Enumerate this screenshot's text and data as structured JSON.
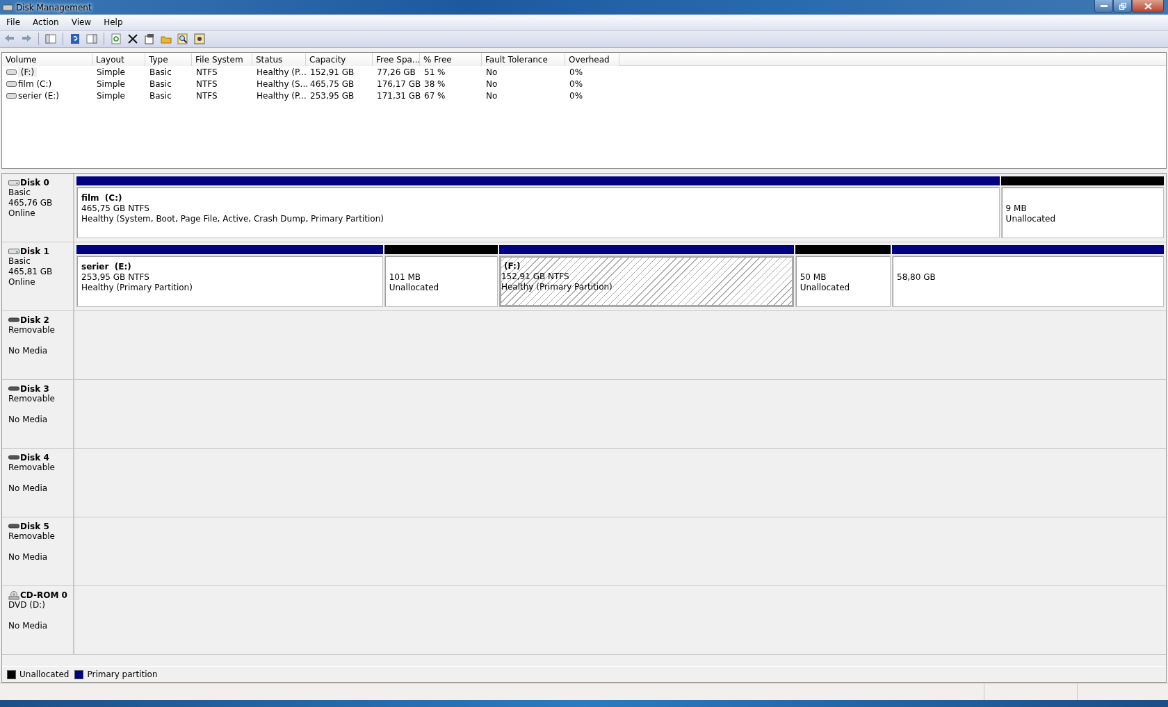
{
  "window": {
    "title": "Disk Management"
  },
  "menu": [
    "File",
    "Action",
    "View",
    "Help"
  ],
  "volume_list": {
    "columns": [
      "Volume",
      "Layout",
      "Type",
      "File System",
      "Status",
      "Capacity",
      "Free Spa...",
      "% Free",
      "Fault Tolerance",
      "Overhead"
    ],
    "rows": [
      {
        "cells": [
          " (F:)",
          "Simple",
          "Basic",
          "NTFS",
          "Healthy (P...",
          "152,91 GB",
          "77,26 GB",
          "51 %",
          "No",
          "0%"
        ],
        "selected": true
      },
      {
        "cells": [
          "film (C:)",
          "Simple",
          "Basic",
          "NTFS",
          "Healthy (S...",
          "465,75 GB",
          "176,17 GB",
          "38 %",
          "No",
          "0%"
        ],
        "selected": false
      },
      {
        "cells": [
          "serier (E:)",
          "Simple",
          "Basic",
          "NTFS",
          "Healthy (P...",
          "253,95 GB",
          "171,31 GB",
          "67 %",
          "No",
          "0%"
        ],
        "selected": false
      }
    ]
  },
  "disks": [
    {
      "kind": "hdd",
      "name": "Disk 0",
      "lines": [
        "Basic",
        "465,76 GB",
        "Online"
      ],
      "partitions": [
        {
          "kind": "primary",
          "name": "film  (C:)",
          "lines": [
            "465,75 GB NTFS",
            "Healthy (System, Boot, Page File, Active, Crash Dump, Primary Partition)"
          ],
          "selected": false
        },
        {
          "kind": "unallocated",
          "lines": [
            "9 MB",
            "Unallocated"
          ],
          "selected": false
        }
      ]
    },
    {
      "kind": "hdd",
      "name": "Disk 1",
      "lines": [
        "Basic",
        "465,81 GB",
        "Online"
      ],
      "partitions": [
        {
          "kind": "primary",
          "name": "serier  (E:)",
          "lines": [
            "253,95 GB NTFS",
            "Healthy (Primary Partition)"
          ],
          "selected": false
        },
        {
          "kind": "unallocated",
          "lines": [
            "101 MB",
            "Unallocated"
          ],
          "selected": false
        },
        {
          "kind": "primary",
          "name": " (F:)",
          "lines": [
            "152,91 GB NTFS",
            "Healthy (Primary Partition)"
          ],
          "selected": true
        },
        {
          "kind": "unallocated",
          "lines": [
            "50 MB",
            "Unallocated"
          ],
          "selected": false
        },
        {
          "kind": "primary",
          "lines": [
            "58,80 GB"
          ],
          "selected": false
        }
      ]
    },
    {
      "kind": "removable",
      "name": "Disk 2",
      "lines": [
        "Removable",
        "No Media"
      ]
    },
    {
      "kind": "removable",
      "name": "Disk 3",
      "lines": [
        "Removable",
        "No Media"
      ]
    },
    {
      "kind": "removable",
      "name": "Disk 4",
      "lines": [
        "Removable",
        "No Media"
      ]
    },
    {
      "kind": "removable",
      "name": "Disk 5",
      "lines": [
        "Removable",
        "No Media"
      ]
    },
    {
      "kind": "cdrom",
      "name": "CD-ROM 0",
      "lines": [
        "DVD (D:)",
        "No Media"
      ]
    }
  ],
  "legend": [
    {
      "label": "Unallocated",
      "color": "#000000"
    },
    {
      "label": "Primary partition",
      "color": "#000080"
    }
  ]
}
